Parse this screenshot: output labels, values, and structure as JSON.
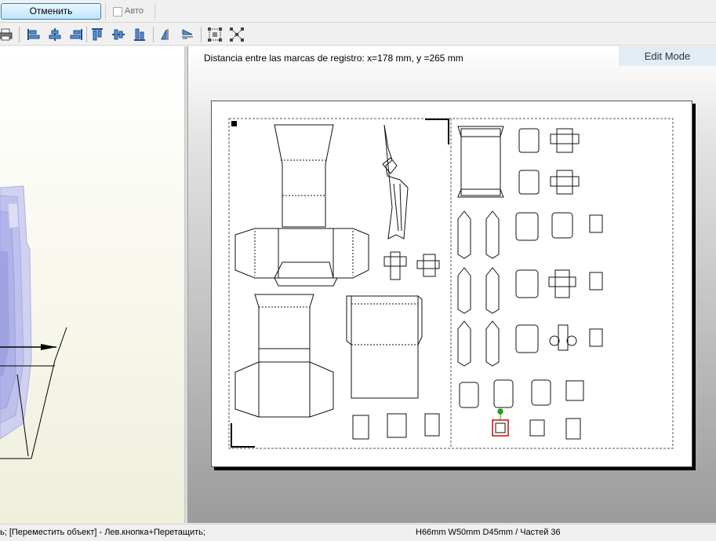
{
  "topbar": {
    "cancel_label": "Отменить",
    "auto_label": "Авто",
    "auto_checked": false
  },
  "toolbar": {
    "buttons": [
      "print-icon",
      "align-left-icon",
      "align-center-h-icon",
      "align-right-icon",
      "align-top-icon",
      "align-middle-v-icon",
      "align-bottom-icon",
      "flip-horizontal-icon",
      "flip-vertical-icon",
      "group-select-icon",
      "ungroup-icon"
    ]
  },
  "editor": {
    "registration_text": "Distancia entre las marcas de registro: x=178 mm, y =265 mm",
    "mode": "Edit Mode"
  },
  "status": {
    "hint": "ь; [Переместить объект] - Лев.кнопка+Перетащить;",
    "dimensions": "H66mm W50mm D45mm / Частей 36"
  },
  "colors": {
    "accent": "#3c7fb1",
    "selection": "#e00000",
    "handle": "#00b000",
    "model_tint": "#a8aee6"
  }
}
